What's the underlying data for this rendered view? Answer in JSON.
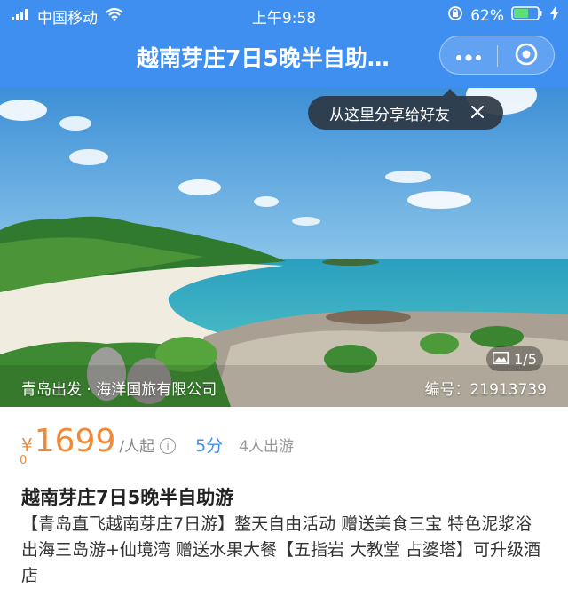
{
  "status_bar": {
    "carrier": "中国移动",
    "time": "上午9:58",
    "battery": "62%",
    "battery_level": 0.62
  },
  "nav": {
    "title": "越南芽庄7日5晚半自助…",
    "icons": [
      "more-icon",
      "close-circle-icon"
    ]
  },
  "tooltip": {
    "text": "从这里分享给好友"
  },
  "gallery": {
    "pager": "1/5",
    "origin": "青岛出发 · 海洋国旅有限公司",
    "code": "编号：21913739"
  },
  "product": {
    "currency": "¥",
    "price": "1699",
    "unit": "/人起",
    "score": "5分",
    "people": "4人出游",
    "trailing_digit": "0",
    "title": "越南芽庄7日5晚半自助游",
    "description": "【青岛直飞越南芽庄7日游】整天自由活动 赠送美食三宝 特色泥浆浴 出海三岛游+仙境湾 赠送水果大餐【五指岩 大教堂 占婆塔】可升级酒店"
  },
  "colors": {
    "header": "#3f8ff0",
    "price": "#f08a3a",
    "score": "#3f8ff0"
  }
}
